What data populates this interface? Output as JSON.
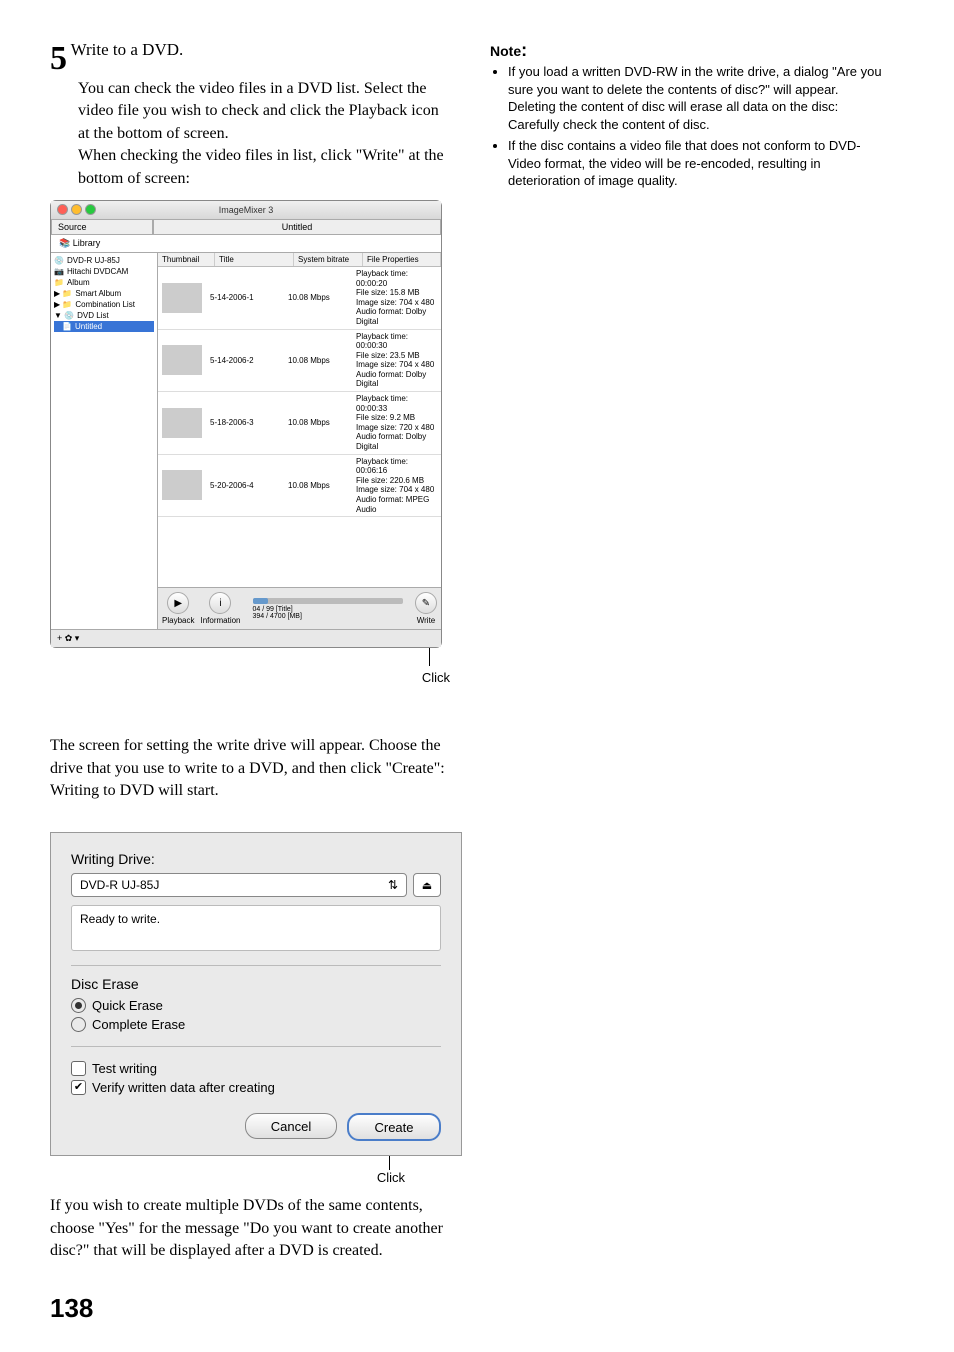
{
  "step": {
    "number": "5",
    "title": "Write to a DVD.",
    "body1": "You can check the video files in a DVD list. Select the video file you wish to check and click the Playback icon at the bottom of screen.",
    "body2": "When checking the video files in list, click \"Write\" at the bottom of screen:"
  },
  "note": {
    "header": "Note",
    "colon": ":",
    "items": [
      "If you load a written DVD-RW in the write drive, a dialog \"Are you sure you want to delete the contents of disc?\" will appear.",
      "Deleting the content of disc will erase all data on the disc: Carefully check the content of disc.",
      "If the disc contains a video file that does not conform to DVD-Video format, the video will be re-encoded, resulting in deterioration of image quality."
    ]
  },
  "im": {
    "title": "ImageMixer 3",
    "tab_source": "Source",
    "tab_untitled": "Untitled",
    "library": "Library",
    "side_items": [
      "DVD-R   UJ-85J",
      "Hitachi DVDCAM",
      "Album",
      "Smart Album",
      "Combination List",
      "DVD List"
    ],
    "side_selected": "Untitled",
    "headers": {
      "thumbnail": "Thumbnail",
      "title": "Title",
      "bitrate": "System bitrate",
      "props": "File Properties"
    },
    "rows": [
      {
        "title": "5-14-2006-1",
        "bitrate": "10.08 Mbps",
        "p1": "Playback time: 00:00:20",
        "p2": "File size: 15.8 MB",
        "p3": "Image size: 704 x 480",
        "p4": "Audio format: Dolby Digital"
      },
      {
        "title": "5-14-2006-2",
        "bitrate": "10.08 Mbps",
        "p1": "Playback time: 00:00:30",
        "p2": "File size: 23.5 MB",
        "p3": "Image size: 704 x 480",
        "p4": "Audio format: Dolby Digital"
      },
      {
        "title": "5-18-2006-3",
        "bitrate": "10.08 Mbps",
        "p1": "Playback time: 00:00:33",
        "p2": "File size: 9.2 MB",
        "p3": "Image size: 720 x 480",
        "p4": "Audio format: Dolby Digital"
      },
      {
        "title": "5-20-2006-4",
        "bitrate": "10.08 Mbps",
        "p1": "Playback time: 00:06:16",
        "p2": "File size: 220.6 MB",
        "p3": "Image size: 704 x 480",
        "p4": "Audio format: MPEG Audio"
      }
    ],
    "playback": "Playback",
    "information": "Information",
    "progress1": "04 / 99 [Title]",
    "progress2": "394 / 4700 [MB]",
    "write": "Write",
    "footer": "+    ✿ ▾"
  },
  "click": "Click",
  "middle_text": "The screen for setting the write drive will appear. Choose the drive that you use to write to a DVD, and then click \"Create\": Writing to DVD will start.",
  "wd": {
    "label": "Writing Drive:",
    "drive": "DVD-R   UJ-85J",
    "status": "Ready to write.",
    "erase_heading": "Disc Erase",
    "quick": "Quick Erase",
    "complete": "Complete Erase",
    "test": "Test writing",
    "verify": "Verify written data after creating",
    "cancel": "Cancel",
    "create": "Create"
  },
  "bottom_text": "If you wish to create multiple DVDs of the same contents, choose \"Yes\" for the message \"Do you want to create another disc?\" that will be displayed after a DVD is created.",
  "page_number": "138"
}
